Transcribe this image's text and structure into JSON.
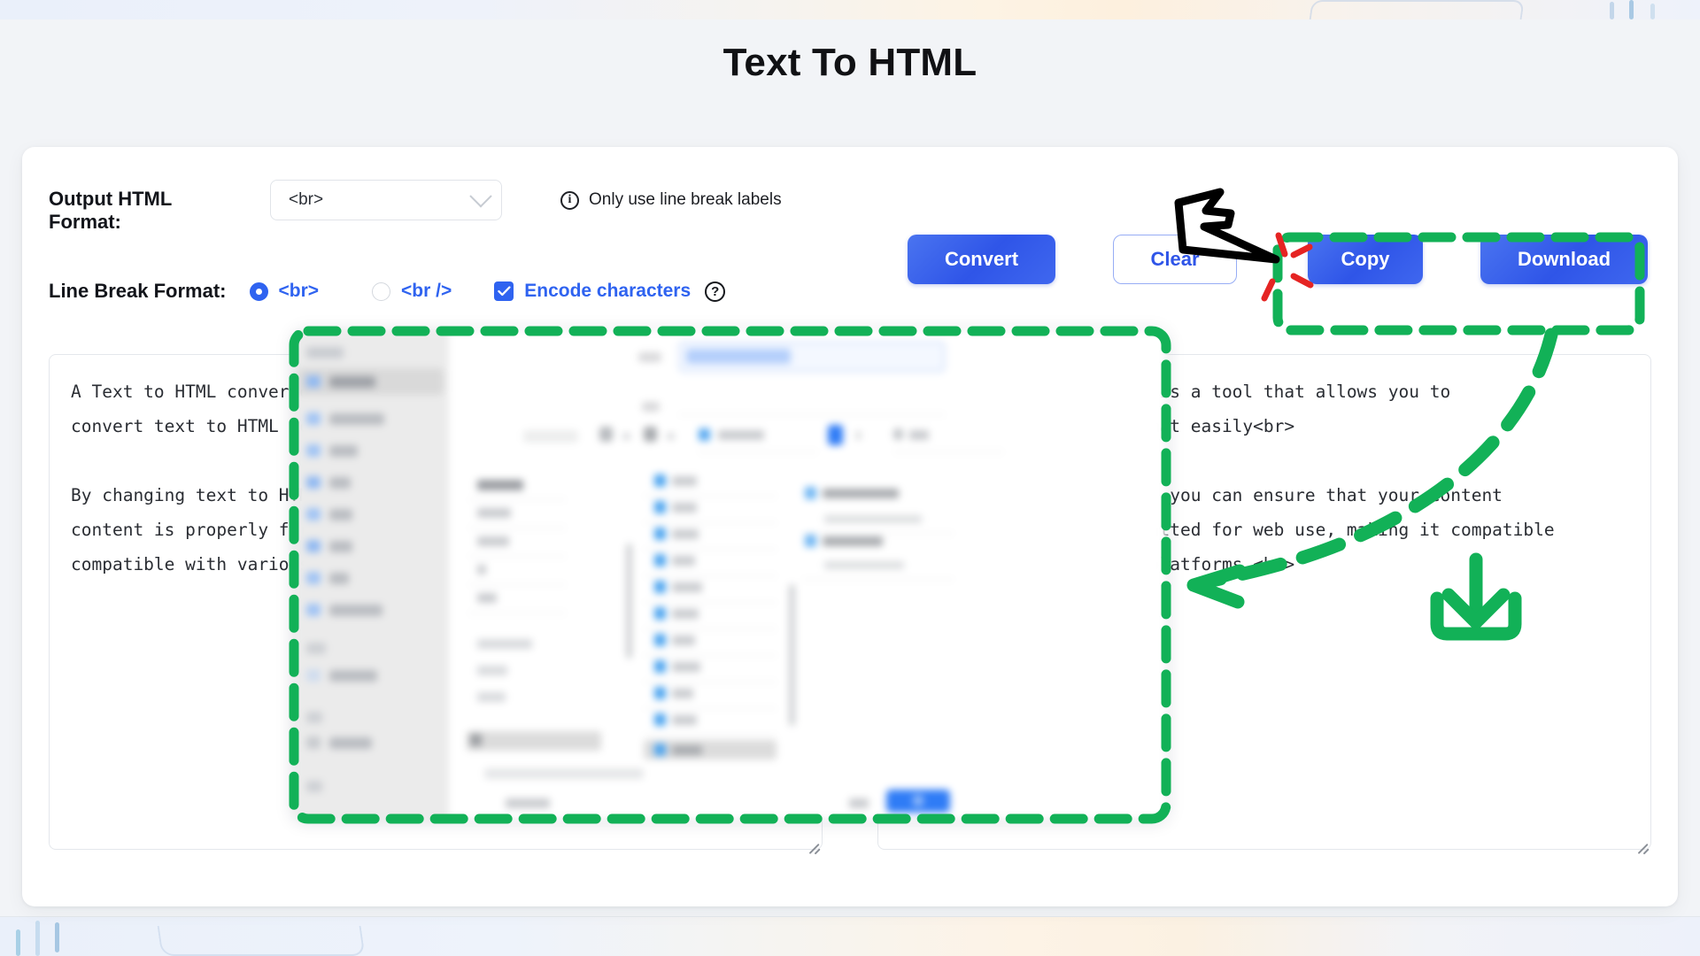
{
  "page": {
    "title": "Text To HTML"
  },
  "controls": {
    "output_format_label": "Output HTML Format:",
    "format_select_value": "<br>",
    "format_select_icon": "chevron-down-icon",
    "hint_icon": "info-icon",
    "hint_text": "Only use line break labels",
    "line_break_format_label": "Line Break Format:",
    "radio_options": [
      {
        "label": "<br>",
        "checked": true
      },
      {
        "label": "<br />",
        "checked": false
      }
    ],
    "encode_checkbox": {
      "label": "Encode characters",
      "checked": true,
      "icon": "check-icon"
    },
    "encode_help_icon": "question-mark-icon"
  },
  "buttons": {
    "convert": "Convert",
    "clear": "Clear",
    "copy": "Copy",
    "download": "Download"
  },
  "editors": {
    "input": {
      "name": "input-textarea",
      "value": "A Text to HTML converter is a tool that allows you to\nconvert text to HTML format easily<br>\n\nBy changing text to HTML, you can ensure that your content\ncontent is properly formatted for web use, making it compatible\ncompatible with various platforms.<br>"
    },
    "output": {
      "name": "output-textarea",
      "value": "A Text to HTML converter is a tool that allows you to\nconvert text to HTML format easily<br>\n\nBy changing text to HTML, you can ensure that your content\ncontent is properly formatted for web use, making it compatible\ncompatible with various platforms.<br>"
    }
  },
  "annotations": {
    "accent_color": "#12b157",
    "click_color": "#e52423",
    "cursor_color": "#000000",
    "highlight_box_buttons": "dashed-rectangle-around-copy-and-download",
    "highlight_box_dialog": "dashed-rectangle-around-save-dialog",
    "curved_arrow": "curved-dashed-arrow-from-download-to-dialog",
    "download_icon": "download-tray-icon"
  },
  "colors": {
    "page_background": "#f2f4f7",
    "card_background": "#ffffff",
    "primary_button": "#2f55e8",
    "link_blue": "#2f63f0",
    "annotation_green": "#12b157",
    "text_dark": "#12141a"
  },
  "overlay_dialog": {
    "name": "blurred-file-save-dialog",
    "description": "blurred screenshot of an operating system file save dialog"
  }
}
